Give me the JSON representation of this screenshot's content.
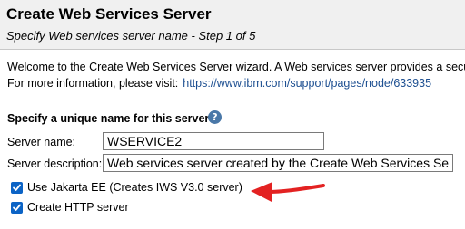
{
  "header": {
    "title": "Create Web Services Server",
    "subtitle": "Specify Web services server name - Step 1 of 5"
  },
  "intro": {
    "welcome": "Welcome to the Create Web Services Server wizard. A Web services server provides a secure",
    "more_info_label": "For more information, please visit:",
    "more_info_link": "https://www.ibm.com/support/pages/node/633935"
  },
  "form": {
    "section_title": "Specify a unique name for this server",
    "help_icon": "help-icon",
    "server_name_label": "Server name:",
    "server_name_value": "WSERVICE2",
    "server_description_label": "Server description:",
    "server_description_value": "Web services server created by the Create Web Services Server wizard",
    "checkboxes": [
      {
        "label": "Use Jakarta EE (Creates IWS V3.0 server)",
        "checked": true
      },
      {
        "label": "Create HTTP server",
        "checked": true
      }
    ]
  },
  "annotation": {
    "arrow_color": "#e32222"
  },
  "colors": {
    "header_bg": "#f0f0f0",
    "link": "#1d4f91",
    "checkbox": "#0b63c5"
  }
}
